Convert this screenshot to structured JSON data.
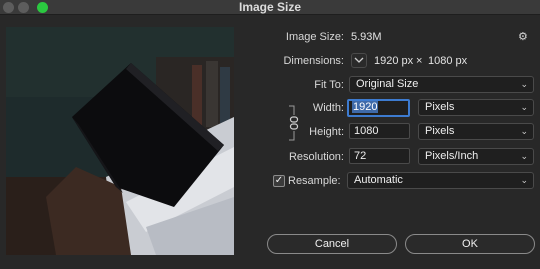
{
  "window": {
    "title": "Image Size"
  },
  "info": {
    "image_size_label": "Image Size:",
    "image_size_value": "5.93M",
    "dimensions_label": "Dimensions:",
    "dim_width": "1920 px",
    "dim_sep": "×",
    "dim_height": "1080 px"
  },
  "fit_to": {
    "label": "Fit To:",
    "value": "Original Size"
  },
  "width": {
    "label": "Width:",
    "value": "1920",
    "unit": "Pixels"
  },
  "height": {
    "label": "Height:",
    "value": "1080",
    "unit": "Pixels"
  },
  "resolution": {
    "label": "Resolution:",
    "value": "72",
    "unit": "Pixels/Inch"
  },
  "resample": {
    "label": "Resample:",
    "value": "Automatic",
    "checked": true,
    "check_glyph": "✓"
  },
  "buttons": {
    "cancel": "Cancel",
    "ok": "OK"
  },
  "icons": {
    "gear": "⚙",
    "chevron": "⌄"
  },
  "colors": {
    "accent": "#3d7bd0",
    "zoom": "#2bc840"
  }
}
